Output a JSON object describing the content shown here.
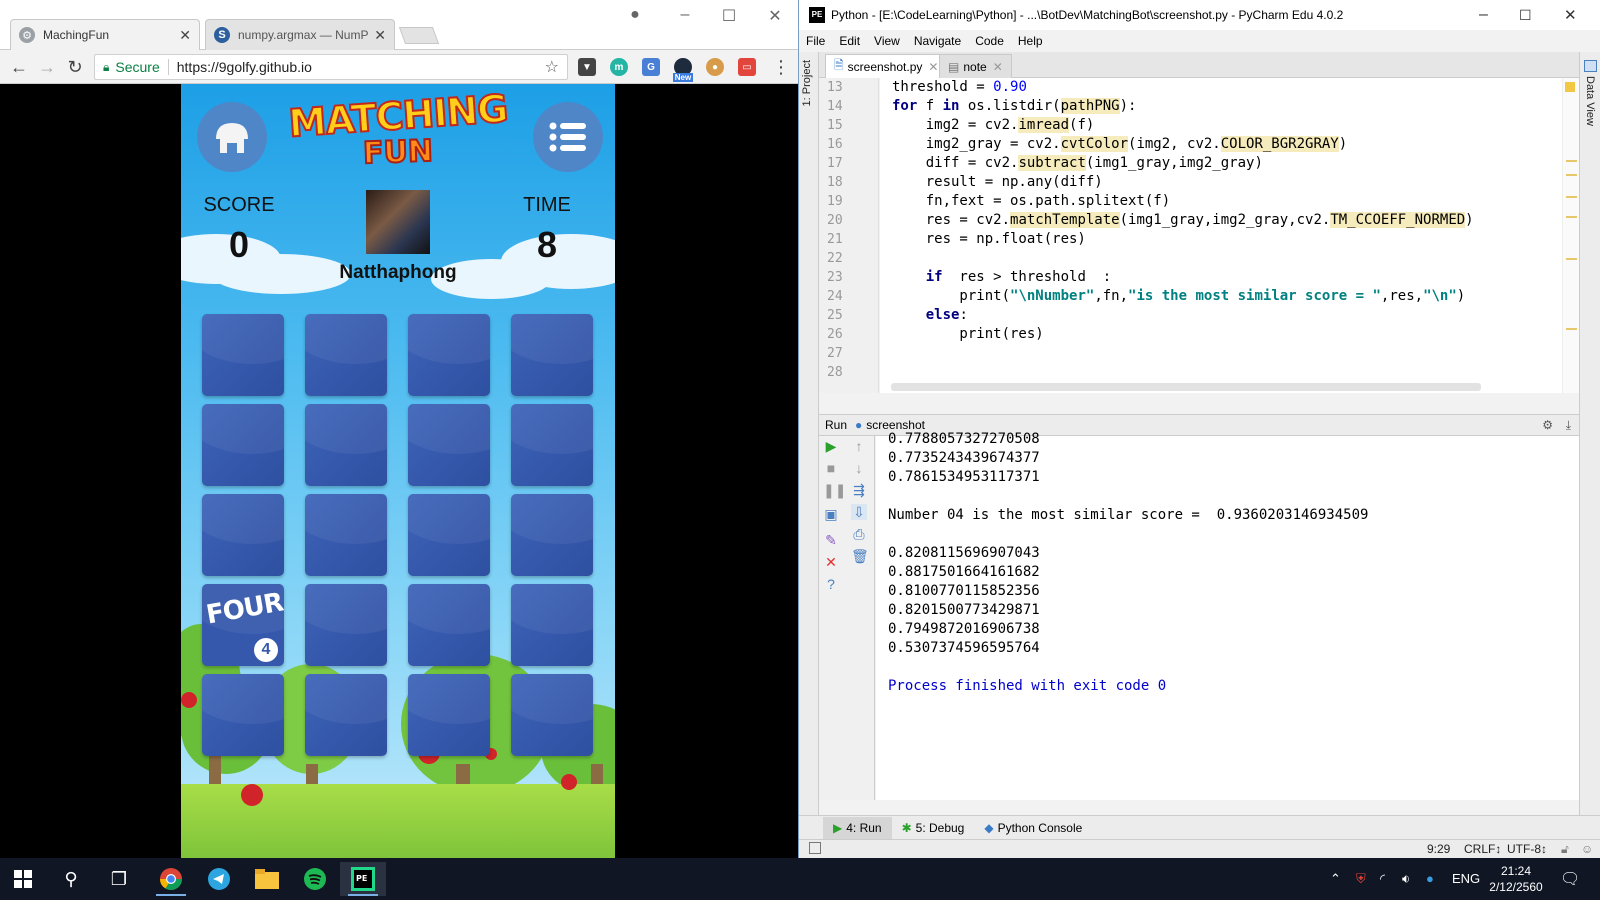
{
  "chrome": {
    "tabs": [
      {
        "title": "MachingFun",
        "active": true
      },
      {
        "title": "numpy.argmax — NumP",
        "active": false
      }
    ],
    "secure_label": "Secure",
    "url": "https://9golfy.github.io",
    "ext_new_badge": "New"
  },
  "game": {
    "logo_line1": "MATCHING",
    "logo_line2": "FUN",
    "score_label": "SCORE",
    "score_value": "0",
    "time_label": "TIME",
    "time_value": "8",
    "player_name": "Natthaphong",
    "revealed_card": {
      "text": "FOUR",
      "number": "4"
    },
    "colors": {
      "card": "#3558ac",
      "sky": "#4dbbf0",
      "grass": "#8ccf3f"
    }
  },
  "pycharm": {
    "title": "Python - [E:\\CodeLearning\\Python] - ...\\BotDev\\MatchingBot\\screenshot.py - PyCharm Edu 4.0.2",
    "menu": [
      "File",
      "Edit",
      "View",
      "Navigate",
      "Code",
      "Help"
    ],
    "left_strip_label": "1: Project",
    "right_strip_label": "Data View",
    "editor_tabs": [
      {
        "name": "screenshot.py",
        "active": true
      },
      {
        "name": "note",
        "active": false
      }
    ],
    "line_numbers": [
      "13",
      "14",
      "15",
      "16",
      "17",
      "18",
      "19",
      "20",
      "21",
      "22",
      "23",
      "24",
      "25",
      "26",
      "27",
      "28"
    ],
    "run_label": "Run",
    "run_config": "screenshot",
    "console_lines": [
      "0.7788057327270508",
      "0.7735243439674377",
      "0.7861534953117371",
      "",
      "Number 04 is the most similar score =  0.9360203146934509",
      "",
      "0.8208115696907043",
      "0.8817501664161682",
      "0.8100770115852356",
      "0.8201500773429871",
      "0.7949872016906738",
      "0.5307374596595764",
      "",
      "Process finished with exit code 0"
    ],
    "bottom_tabs": [
      "4: Run",
      "5: Debug",
      "Python Console"
    ],
    "status": {
      "position": "9:29",
      "line_sep": "CRLF↕",
      "encoding": "UTF-8↕"
    }
  },
  "taskbar": {
    "lang": "ENG",
    "time": "21:24",
    "date": "2/12/2560"
  }
}
